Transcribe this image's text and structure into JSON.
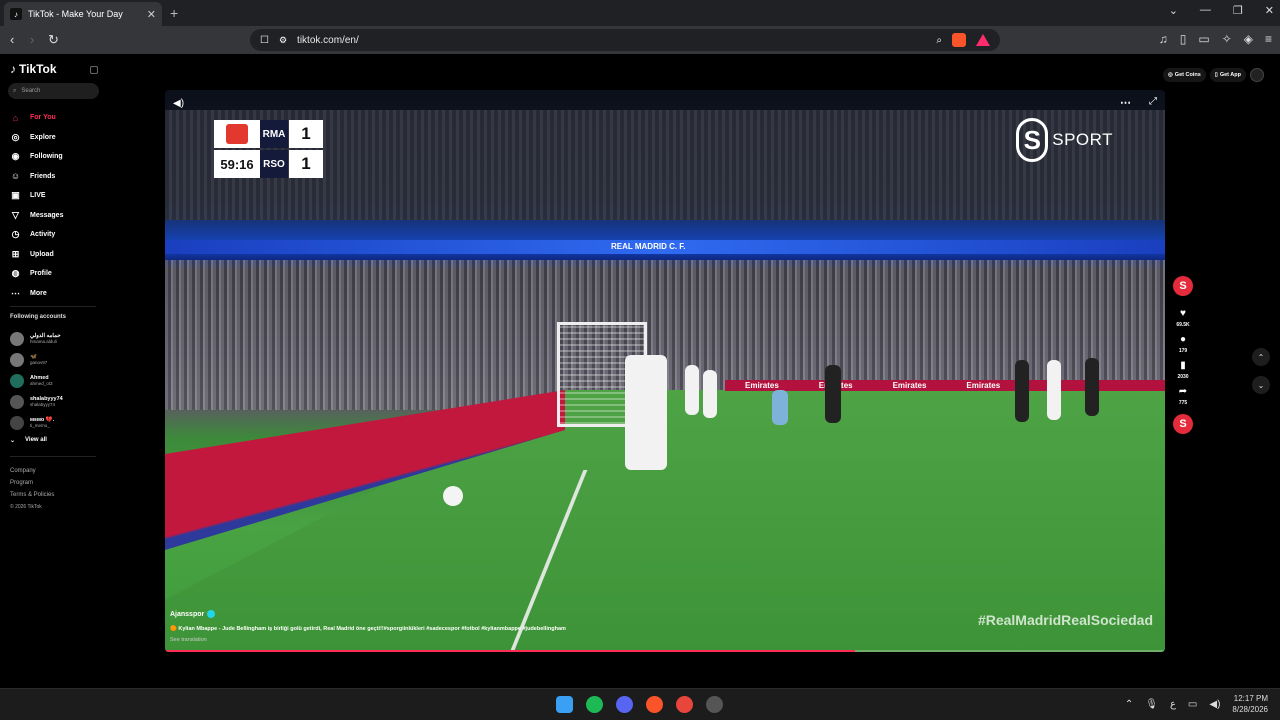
{
  "browser": {
    "tab_title": "TikTok - Make Your Day",
    "tab_close": "✕",
    "new_tab": "+",
    "url": "tiktok.com/en/",
    "window_controls": [
      "⌄",
      "—",
      "❐",
      "✕"
    ],
    "nav": {
      "back": "‹",
      "forward": "›",
      "reload": "↻"
    }
  },
  "sidebar": {
    "logo": "TikTok",
    "search_placeholder": "Search",
    "menu": [
      {
        "label": "For You",
        "icon": "home-icon",
        "glyph": "⌂"
      },
      {
        "label": "Explore",
        "icon": "compass-icon",
        "glyph": "◎"
      },
      {
        "label": "Following",
        "icon": "following-icon",
        "glyph": "◉"
      },
      {
        "label": "Friends",
        "icon": "friends-icon",
        "glyph": "☺"
      },
      {
        "label": "LIVE",
        "icon": "live-icon",
        "glyph": "▣"
      },
      {
        "label": "Messages",
        "icon": "messages-icon",
        "glyph": "▽"
      },
      {
        "label": "Activity",
        "icon": "activity-icon",
        "glyph": "◷"
      },
      {
        "label": "Upload",
        "icon": "upload-icon",
        "glyph": "⊞"
      },
      {
        "label": "Profile",
        "icon": "profile-icon",
        "glyph": "◍"
      },
      {
        "label": "More",
        "icon": "more-icon",
        "glyph": "⋯"
      }
    ],
    "following_title": "Following accounts",
    "following": [
      {
        "name": "حمامه الدولي",
        "handle": "hmama.alduli"
      },
      {
        "name": "🦋",
        "handle": "ganov97"
      },
      {
        "name": "Ahmed",
        "handle": "ahmed_ot3"
      },
      {
        "name": "shalabyyy74",
        "handle": "shalabyyy74"
      },
      {
        "name": "ᴍᴇᴍᴏ 💔.",
        "handle": "ti_memo_"
      }
    ],
    "view_all": "View all",
    "footer": [
      "Company",
      "Program",
      "Terms & Policies"
    ],
    "copyright": "© 2026 TikTok"
  },
  "topright": {
    "coins": "Get Coins",
    "app": "Get App"
  },
  "video": {
    "scoreboard": {
      "clock": "59:16",
      "home": "RMA",
      "away": "RSO",
      "home_goals": "1",
      "away_goals": "1"
    },
    "broadcaster": "SPORT",
    "band_text": "REAL MADRID C. F.",
    "ads_text": [
      "Emirates",
      "Emirates",
      "Emirates",
      "Emirates"
    ],
    "hashtag_overlay": "#RealMadridRealSociedad",
    "author": "Ajansspor",
    "caption": "🟠 Kylian Mbappe - Jude Bellingham iş birliği golü getirdi, Real Madrid öne geçti!!#sporgiinlükleri #sadecespor #fotbol #kylianmbappe #judebellingham",
    "see_translation": "See translation",
    "progress": 0.69
  },
  "actions": {
    "likes": "69.5K",
    "comments": "179",
    "saves": "2030",
    "shares": "775"
  },
  "taskbar": {
    "time": "12:17 PM",
    "date": "8/28/2026",
    "apps": [
      {
        "name": "windows-start-icon",
        "color": "#3aa0f3"
      },
      {
        "name": "spotify-icon",
        "color": "#1db954"
      },
      {
        "name": "discord-icon",
        "color": "#5865f2"
      },
      {
        "name": "brave-icon",
        "color": "#fb542b"
      },
      {
        "name": "chrome-icon",
        "color": "#e8453c"
      },
      {
        "name": "steam-icon",
        "color": "#555555"
      }
    ]
  }
}
